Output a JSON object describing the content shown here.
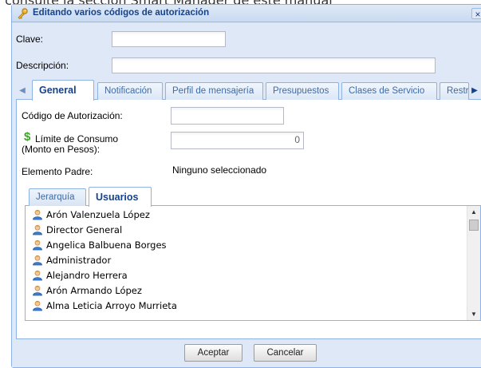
{
  "background_doc": {
    "text": ", consulte la sección Smart Manager de este manual"
  },
  "dialog": {
    "title": "Editando varios códigos de autorización",
    "close_label": "×"
  },
  "form": {
    "clave_label": "Clave:",
    "clave_value": "",
    "descripcion_label": "Descripción:",
    "descripcion_value": ""
  },
  "tabs": [
    {
      "label": "General",
      "active": true
    },
    {
      "label": "Notificación",
      "active": false
    },
    {
      "label": "Perfil de mensajería",
      "active": false
    },
    {
      "label": "Presupuestos",
      "active": false
    },
    {
      "label": "Clases de Servicio",
      "active": false
    },
    {
      "label": "Restr",
      "active": false
    }
  ],
  "general": {
    "codigo_label": "Código de Autorización:",
    "codigo_value": "",
    "limite_label_line1": "Límite de Consumo",
    "limite_label_line2": "(Monto en Pesos):",
    "limite_value": "0",
    "elemento_label": "Elemento Padre:",
    "elemento_value": "Ninguno seleccionado"
  },
  "inner_tabs": [
    {
      "label": "Jerarquía",
      "active": false
    },
    {
      "label": "Usuarios",
      "active": true
    }
  ],
  "users": [
    "Arón Valenzuela López",
    "Director General",
    "Angelica Balbuena Borges",
    "Administrador",
    "Alejandro Herrera",
    "Arón Armando López",
    "Alma Leticia Arroyo Murrieta"
  ],
  "buttons": {
    "accept": "Aceptar",
    "cancel": "Cancelar"
  },
  "icons": {
    "title": "key-icon",
    "tab_scroll_left": "arrow-left-icon",
    "tab_scroll_right": "arrow-right-icon",
    "money": "dollar-icon",
    "user": "user-icon"
  },
  "colors": {
    "title_text": "#15428b",
    "money_icon": "#3fa22a",
    "dialog_border": "#8db2e3"
  }
}
